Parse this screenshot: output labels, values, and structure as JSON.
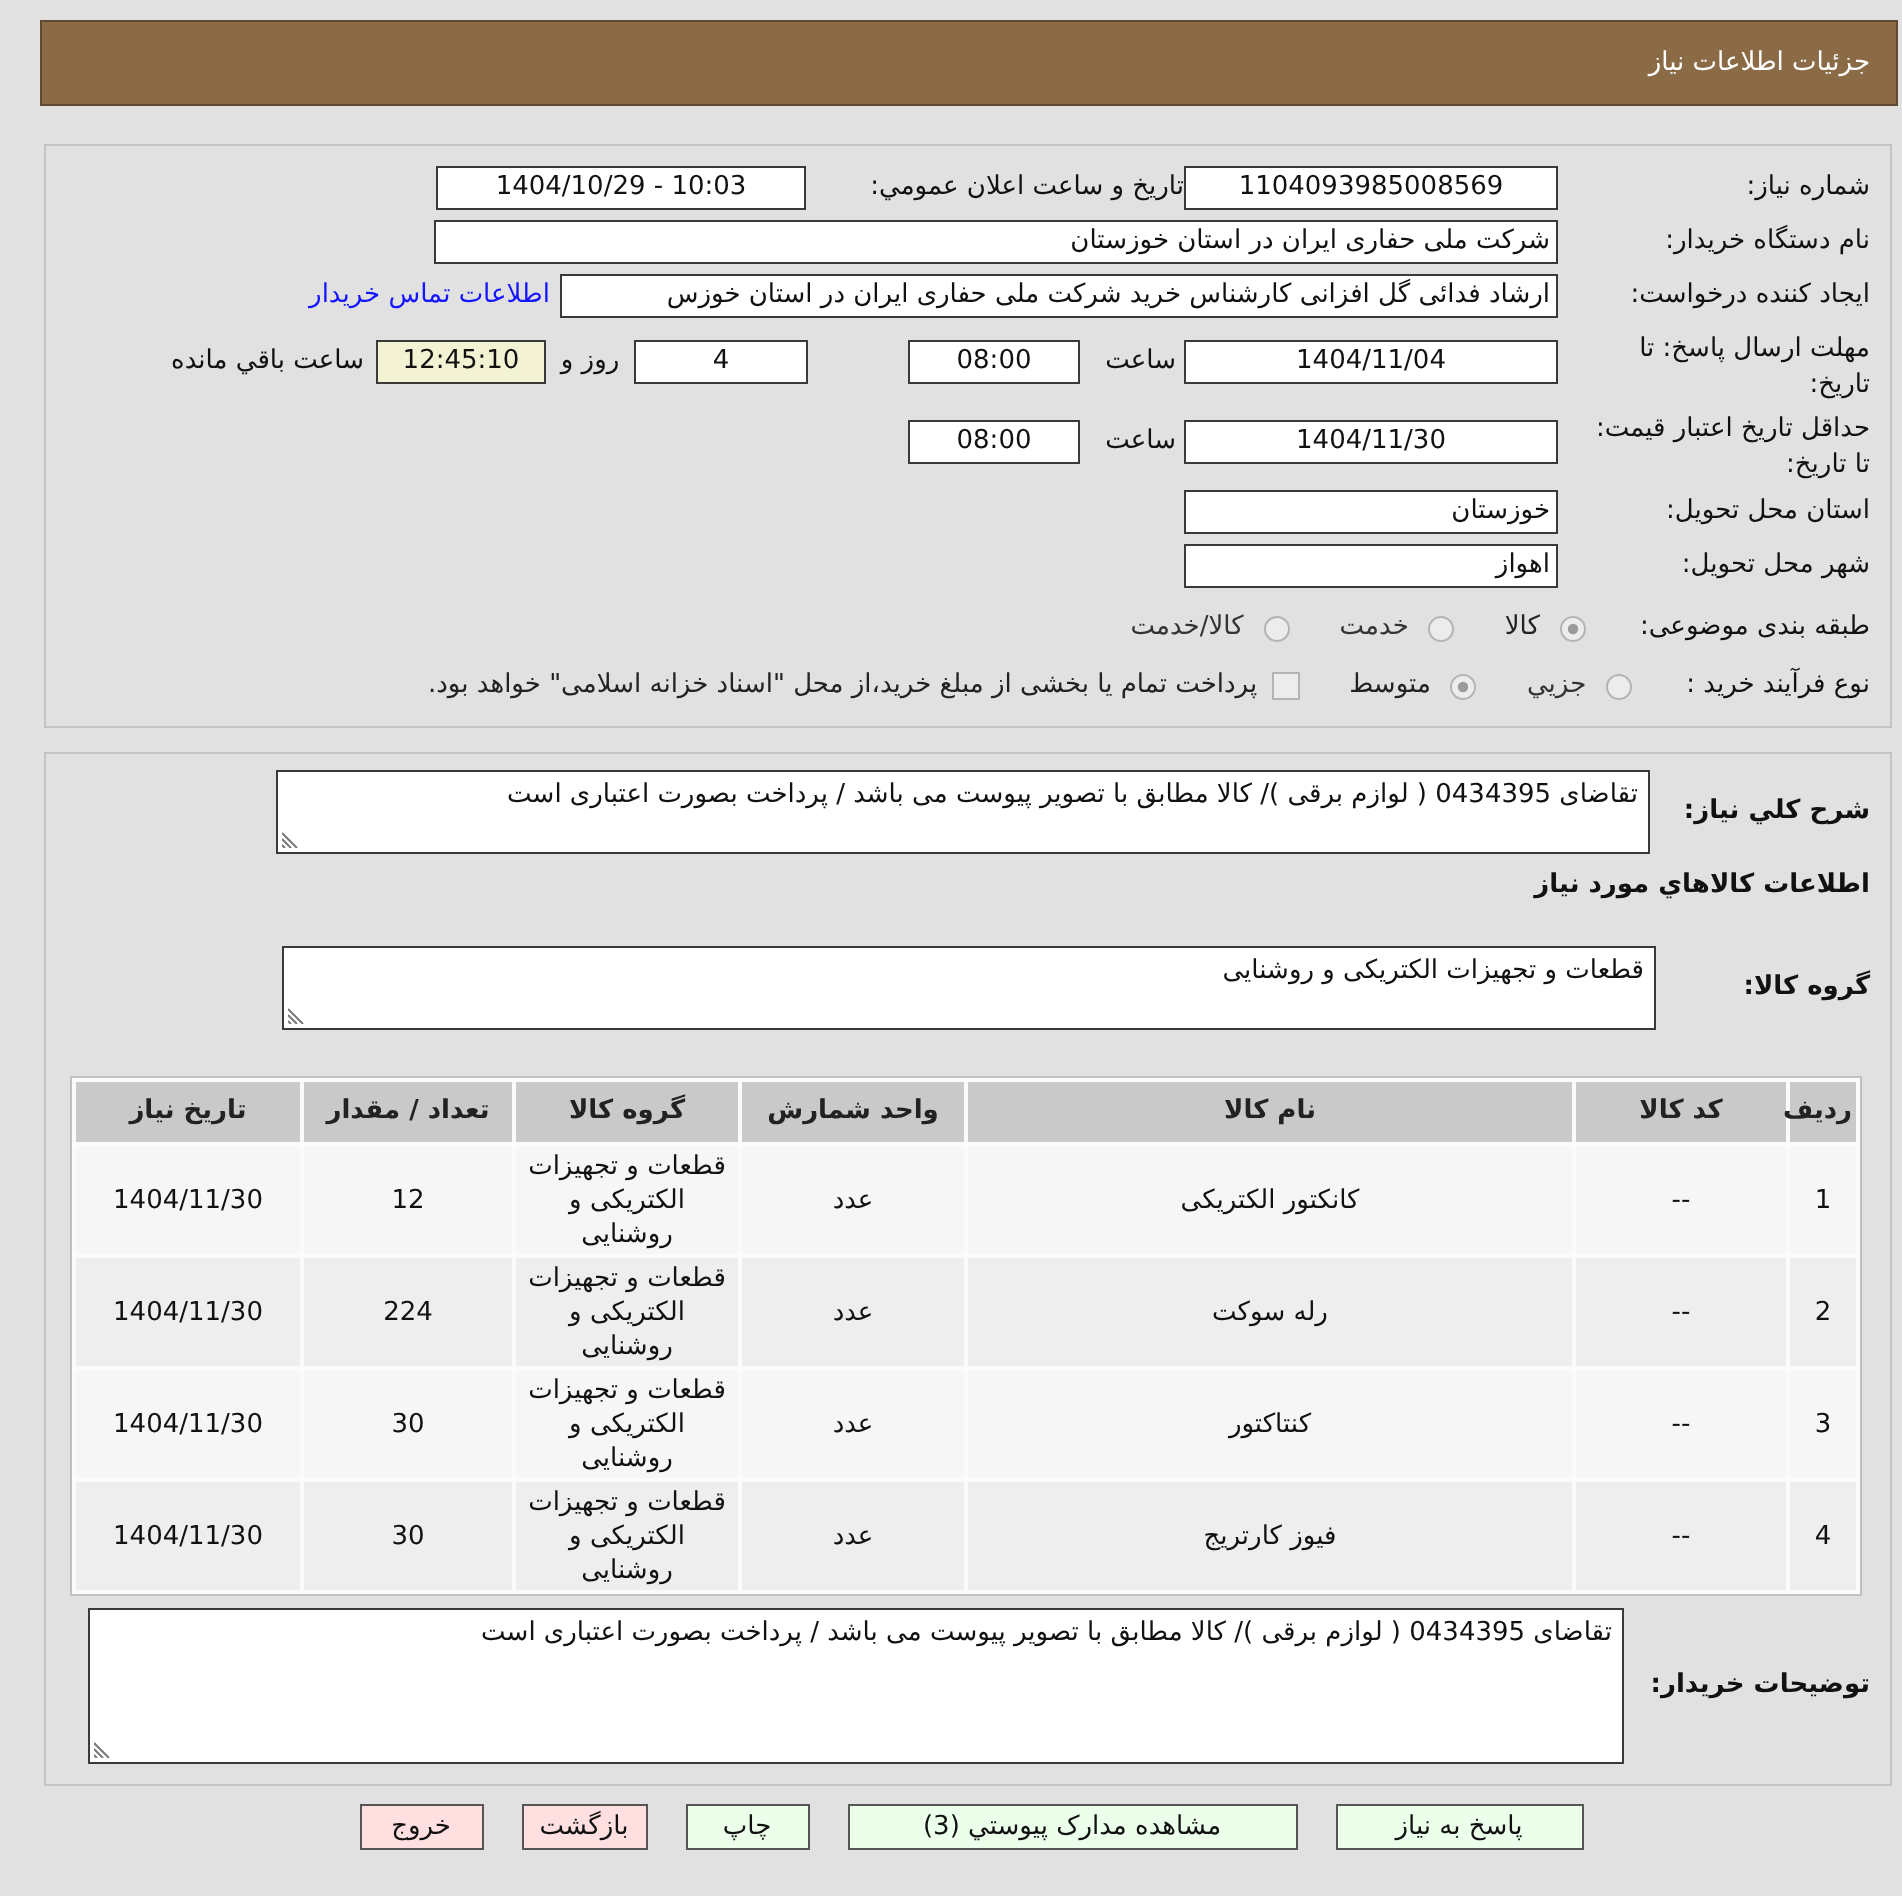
{
  "header": {
    "title": "جزئیات اطلاعات نیاز"
  },
  "general": {
    "need_number": {
      "label": "شماره نیاز:",
      "value": "1104093985008569"
    },
    "announcement": {
      "label": "تاریخ و ساعت اعلان عمومي:",
      "value": "1404/10/29 - 10:03"
    },
    "buyer_organization": {
      "label": "نام دستگاه خریدار:",
      "value": "شرکت ملی حفاری ایران در استان خوزستان"
    },
    "requester": {
      "label": "ایجاد کننده درخواست:",
      "value": "ارشاد فدائی گل افزانی کارشناس خرید شرکت ملی حفاری ایران در استان خوزس",
      "link": "اطلاعات تماس خریدار"
    },
    "reply_deadline": {
      "label": "مهلت ارسال پاسخ: تا تاریخ:",
      "date": "1404/11/04",
      "time_label": "ساعت",
      "time": "08:00",
      "days": "4",
      "days_label": "روز و",
      "remaining": "12:45:10",
      "remaining_label": "ساعت باقي مانده"
    },
    "price_validity": {
      "label": "حداقل تاریخ اعتبار قیمت: تا تاریخ:",
      "date": "1404/11/30",
      "time_label": "ساعت",
      "time": "08:00"
    },
    "delivery_province": {
      "label": "استان محل تحویل:",
      "value": "خوزستان"
    },
    "delivery_city": {
      "label": "شهر محل تحویل:",
      "value": "اهواز"
    },
    "category": {
      "label": "طبقه بندی موضوعی:",
      "options": [
        {
          "label": "کالا",
          "selected": true
        },
        {
          "label": "خدمت",
          "selected": false
        },
        {
          "label": "کالا/خدمت",
          "selected": false
        }
      ]
    },
    "purchase_type": {
      "label": "نوع فرآیند خرید :",
      "options": [
        {
          "label": "جزيي",
          "selected": false
        },
        {
          "label": "متوسط",
          "selected": true
        }
      ],
      "treasury_payment": {
        "checked": false,
        "label": "پرداخت تمام یا بخشی از مبلغ خرید،از محل \"اسناد خزانه اسلامی\" خواهد بود."
      }
    }
  },
  "needs": {
    "description": {
      "label": "شرح کلي نياز:",
      "value": "تقاضای 0434395 ( لوازم برقی )/ کالا مطابق با تصویر پیوست می باشد / پرداخت بصورت اعتباری است"
    },
    "goods_heading": "اطلاعات کالاهاي مورد نياز",
    "goods_group": {
      "label": "گروه کالا:",
      "value": "قطعات و تجهیزات الکتریکی و روشنایی"
    },
    "table": {
      "columns": [
        "ردیف",
        "کد کالا",
        "نام کالا",
        "واحد شمارش",
        "گروه کالا",
        "تعداد / مقدار",
        "تاریخ نیاز"
      ],
      "rows": [
        [
          "1",
          "--",
          "کانکتور الکتریکی",
          "عدد",
          "قطعات و تجهیزات الکتریکی و روشنایی",
          "12",
          "1404/11/30"
        ],
        [
          "2",
          "--",
          "رله سوکت",
          "عدد",
          "قطعات و تجهیزات الکتریکی و روشنایی",
          "224",
          "1404/11/30"
        ],
        [
          "3",
          "--",
          "کنتاکتور",
          "عدد",
          "قطعات و تجهیزات الکتریکی و روشنایی",
          "30",
          "1404/11/30"
        ],
        [
          "4",
          "--",
          "فیوز کارتریج",
          "عدد",
          "قطعات و تجهیزات الکتریکی و روشنایی",
          "30",
          "1404/11/30"
        ]
      ]
    },
    "buyer_notes": {
      "label": "توضیحات خریدار:",
      "value": "تقاضای 0434395 ( لوازم برقی )/ کالا مطابق با تصویر پیوست می باشد / پرداخت بصورت اعتباری است"
    }
  },
  "buttons": [
    {
      "label": "پاسخ به نیاز",
      "kind": "positive"
    },
    {
      "label": "مشاهده مدارک پيوستي (3)",
      "kind": "positive"
    },
    {
      "label": "چاپ",
      "kind": "positive"
    },
    {
      "label": "بازگشت",
      "kind": "negative"
    },
    {
      "label": "خروج",
      "kind": "negative"
    }
  ]
}
